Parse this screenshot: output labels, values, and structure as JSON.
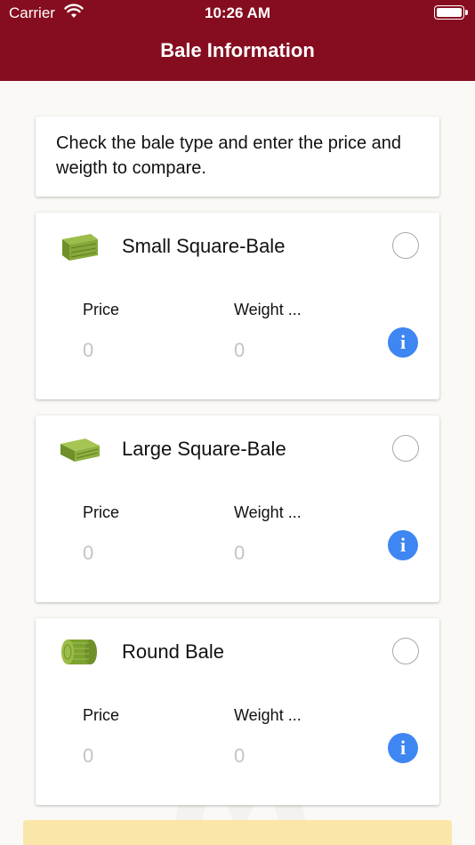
{
  "status_bar": {
    "carrier": "Carrier",
    "time": "10:26 AM",
    "wifi_icon": "wifi-icon",
    "battery_icon": "battery-icon"
  },
  "header": {
    "title": "Bale Information",
    "background_color": "#860d1f"
  },
  "instruction": {
    "text": "Check the bale type and enter the price and weigth to compare."
  },
  "bales": [
    {
      "name": "Small Square-Bale",
      "image": "small-square-bale-image",
      "price_label": "Price",
      "weight_label": "Weight ...",
      "price_placeholder": "0",
      "weight_placeholder": "0",
      "selected": false
    },
    {
      "name": "Large Square-Bale",
      "image": "large-square-bale-image",
      "price_label": "Price",
      "weight_label": "Weight ...",
      "price_placeholder": "0",
      "weight_placeholder": "0",
      "selected": false
    },
    {
      "name": "Round Bale",
      "image": "round-bale-image",
      "price_label": "Price",
      "weight_label": "Weight ...",
      "price_placeholder": "0",
      "weight_placeholder": "0",
      "selected": false
    }
  ],
  "info_button": {
    "glyph": "i",
    "color": "#3e86f2"
  },
  "bottom_button": {
    "color": "#fbe6a9"
  },
  "watermark": {
    "line1": "HAY PRICE",
    "line2": "CALCULATOR"
  }
}
